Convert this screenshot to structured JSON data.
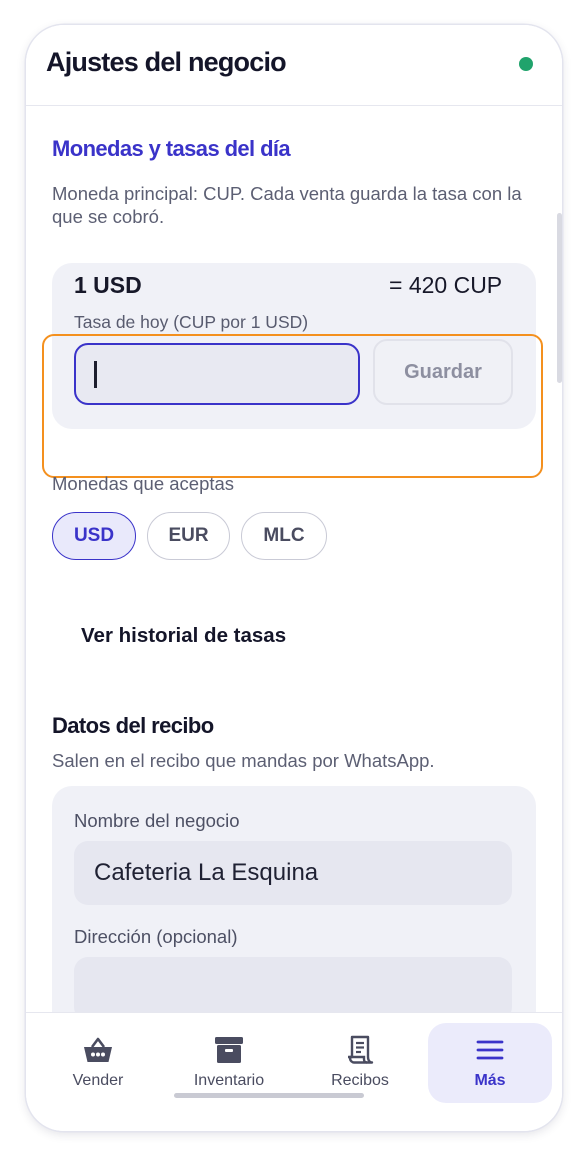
{
  "header": {
    "title": "Ajustes del negocio",
    "status_color": "#20a36c"
  },
  "currency_section": {
    "title": "Monedas y tasas del día",
    "description": "Moneda principal: CUP. Cada venta guarda la tasa con la que se cobró.",
    "rate": {
      "base": "1 USD",
      "equals": "= 420 CUP",
      "label": "Tasa de hoy (CUP por 1 USD)",
      "input_value": "",
      "save_label": "Guardar"
    },
    "accepts_label": "Monedas que aceptas",
    "currencies": [
      {
        "code": "USD",
        "selected": true
      },
      {
        "code": "EUR",
        "selected": false
      },
      {
        "code": "MLC",
        "selected": false
      }
    ],
    "history_link": "Ver historial de tasas"
  },
  "receipt_section": {
    "title": "Datos del recibo",
    "description": "Salen en el recibo que mandas por WhatsApp.",
    "business_name_label": "Nombre del negocio",
    "business_name_value": "Cafeteria La Esquina",
    "address_label": "Dirección (opcional)",
    "address_value": ""
  },
  "tabs": [
    {
      "label": "Vender",
      "icon": "basket-icon",
      "active": false
    },
    {
      "label": "Inventario",
      "icon": "archive-box-icon",
      "active": false
    },
    {
      "label": "Recibos",
      "icon": "receipt-icon",
      "active": false
    },
    {
      "label": "Más",
      "icon": "menu-icon",
      "active": true
    }
  ],
  "colors": {
    "accent": "#3a33c9",
    "highlight": "#f4901e",
    "status": "#20a36c"
  }
}
